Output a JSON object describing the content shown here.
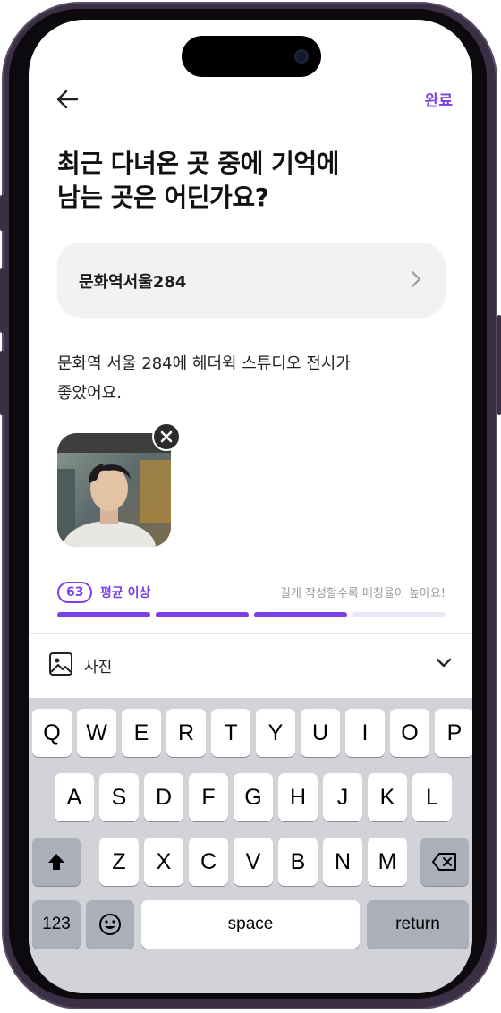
{
  "header": {
    "done_label": "완료"
  },
  "question": {
    "title": "최근 다녀온 곳 중에 기억에\n남는 곳은 어딘가요?"
  },
  "place": {
    "name": "문화역서울284"
  },
  "review": {
    "text": "문화역 서울 284에 헤더윅 스튜디오 전시가\n좋았어요."
  },
  "score": {
    "value": "63",
    "level": "평균 이상",
    "hint": "길게 작성할수록 매칭율이 높아요!",
    "filled_segments": 3,
    "total_segments": 4
  },
  "toolbar": {
    "photo_label": "사진"
  },
  "keyboard": {
    "row1": [
      "Q",
      "W",
      "E",
      "R",
      "T",
      "Y",
      "U",
      "I",
      "O",
      "P"
    ],
    "row2": [
      "A",
      "S",
      "D",
      "F",
      "G",
      "H",
      "J",
      "K",
      "L"
    ],
    "row3": [
      "Z",
      "X",
      "C",
      "V",
      "B",
      "N",
      "M"
    ],
    "numbers_label": "123",
    "space_label": "space",
    "return_label": "return"
  },
  "colors": {
    "accent": "#7b3fe4",
    "accent_light": "#ece6fb",
    "keyboard_bg": "#d1d3d9"
  }
}
